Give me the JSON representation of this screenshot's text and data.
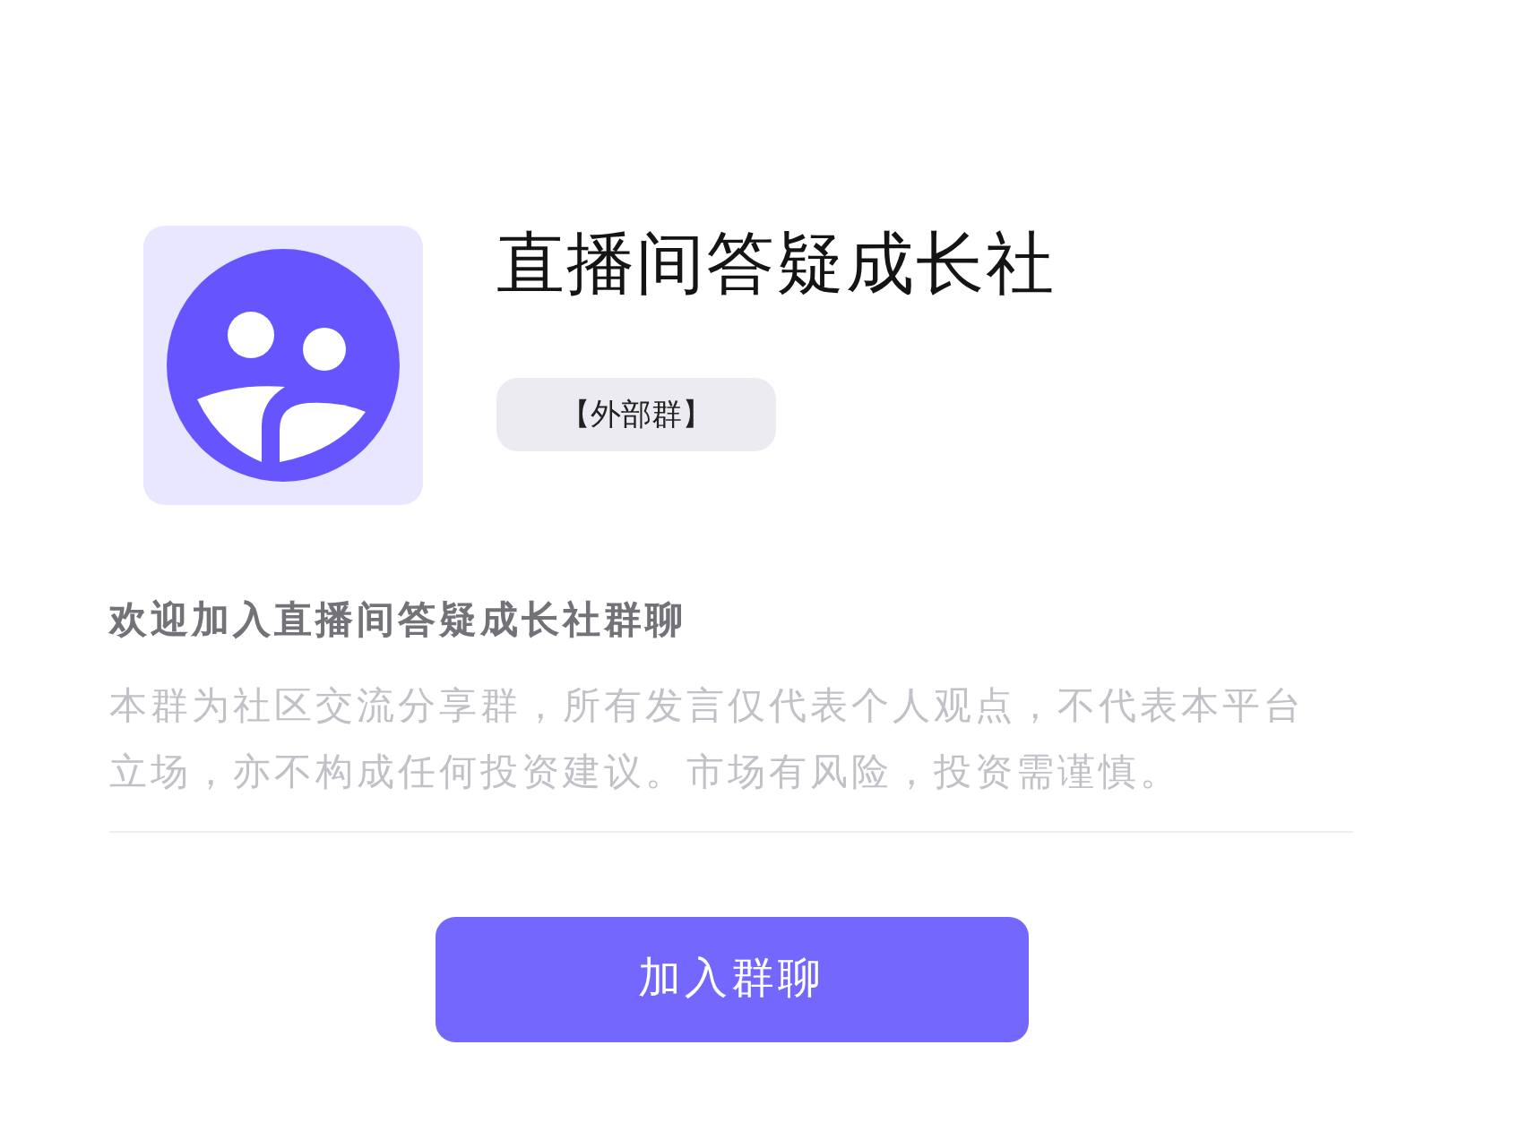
{
  "group": {
    "name": "直播间答疑成长社",
    "tag": "【外部群】"
  },
  "welcome": {
    "title": "欢迎加入直播间答疑成长社群聊",
    "notice": "本群为社区交流分享群，所有发言仅代表个人观点，不代表本平台立场，亦不构成任何投资建议。市场有风险，投资需谨慎。"
  },
  "join_button": {
    "label": "加入群聊"
  }
}
